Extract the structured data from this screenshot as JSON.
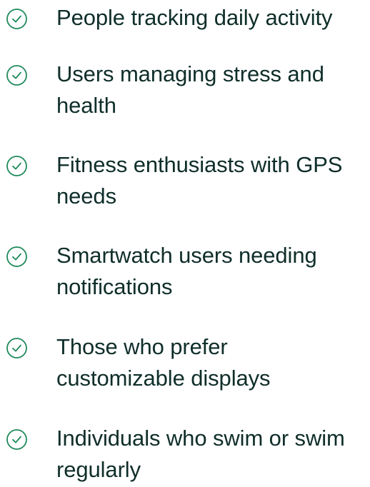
{
  "colors": {
    "text": "#0f2e2a",
    "check_icon": "#1f8a5b"
  },
  "feature_list": {
    "icon": "check-circle-icon",
    "items": [
      {
        "label": "People tracking daily activity"
      },
      {
        "label": "Users managing stress and health"
      },
      {
        "label": "Fitness enthusiasts with GPS needs"
      },
      {
        "label": "Smartwatch users needing notifications"
      },
      {
        "label": "Those who prefer customizable displays"
      },
      {
        "label": "Individuals who swim or swim regularly"
      }
    ]
  }
}
